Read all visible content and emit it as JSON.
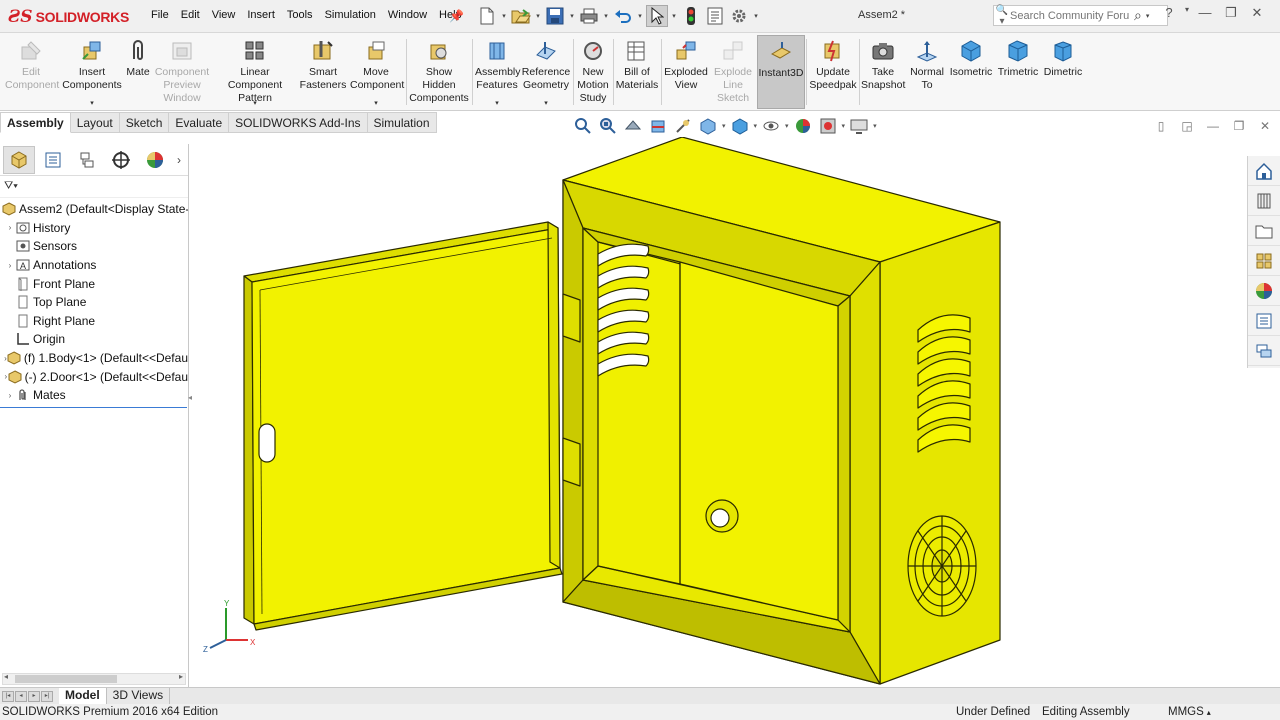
{
  "app": {
    "brand": "SOLIDWORKS",
    "document_title": "Assem2 *"
  },
  "menu": [
    "File",
    "Edit",
    "View",
    "Insert",
    "Tools",
    "Simulation",
    "Window",
    "Help"
  ],
  "search": {
    "placeholder": "Search Community Forum"
  },
  "ribbon": {
    "edit_component": "Edit Component",
    "insert_components": "Insert Components",
    "mate": "Mate",
    "component_preview_window": "Component Preview Window",
    "linear_component_pattern": "Linear Component Pattern",
    "smart_fasteners": "Smart Fasteners",
    "move_component": "Move Component",
    "show_hidden_components": "Show Hidden Components",
    "assembly_features": "Assembly Features",
    "reference_geometry": "Reference Geometry",
    "new_motion_study": "New Motion Study",
    "bill_of_materials": "Bill of Materials",
    "exploded_view": "Exploded View",
    "explode_line_sketch": "Explode Line Sketch",
    "instant3d": "Instant3D",
    "update_speedpak": "Update Speedpak",
    "take_snapshot": "Take Snapshot",
    "normal_to": "Normal To",
    "isometric": "Isometric",
    "trimetric": "Trimetric",
    "dimetric": "Dimetric"
  },
  "tabs": [
    "Assembly",
    "Layout",
    "Sketch",
    "Evaluate",
    "SOLIDWORKS Add-Ins",
    "Simulation"
  ],
  "tree": {
    "root": "Assem2  (Default<Display State-1",
    "items": [
      {
        "label": "History",
        "icon": "history-icon",
        "expandable": true
      },
      {
        "label": "Sensors",
        "icon": "sensors-icon",
        "expandable": false
      },
      {
        "label": "Annotations",
        "icon": "annotations-icon",
        "expandable": true
      },
      {
        "label": "Front Plane",
        "icon": "plane-icon",
        "expandable": false
      },
      {
        "label": "Top Plane",
        "icon": "plane-icon",
        "expandable": false
      },
      {
        "label": "Right Plane",
        "icon": "plane-icon",
        "expandable": false
      },
      {
        "label": "Origin",
        "icon": "origin-icon",
        "expandable": false
      },
      {
        "label": "(f) 1.Body<1>  (Default<<Defau",
        "icon": "part-icon",
        "expandable": true
      },
      {
        "label": "(-) 2.Door<1>  (Default<<Defau",
        "icon": "part-icon",
        "expandable": true
      },
      {
        "label": "Mates",
        "icon": "mates-icon",
        "expandable": true
      }
    ]
  },
  "model_tabs": [
    "Model",
    "3D Views"
  ],
  "status": {
    "edition": "SOLIDWORKS Premium 2016 x64 Edition",
    "state": "Under Defined",
    "mode": "Editing Assembly",
    "units": "MMGS"
  },
  "colors": {
    "model_yellow": "#f2f200",
    "model_edge": "#2a2a00",
    "brand_red": "#d32027",
    "accent_blue": "#1c6fbf"
  }
}
